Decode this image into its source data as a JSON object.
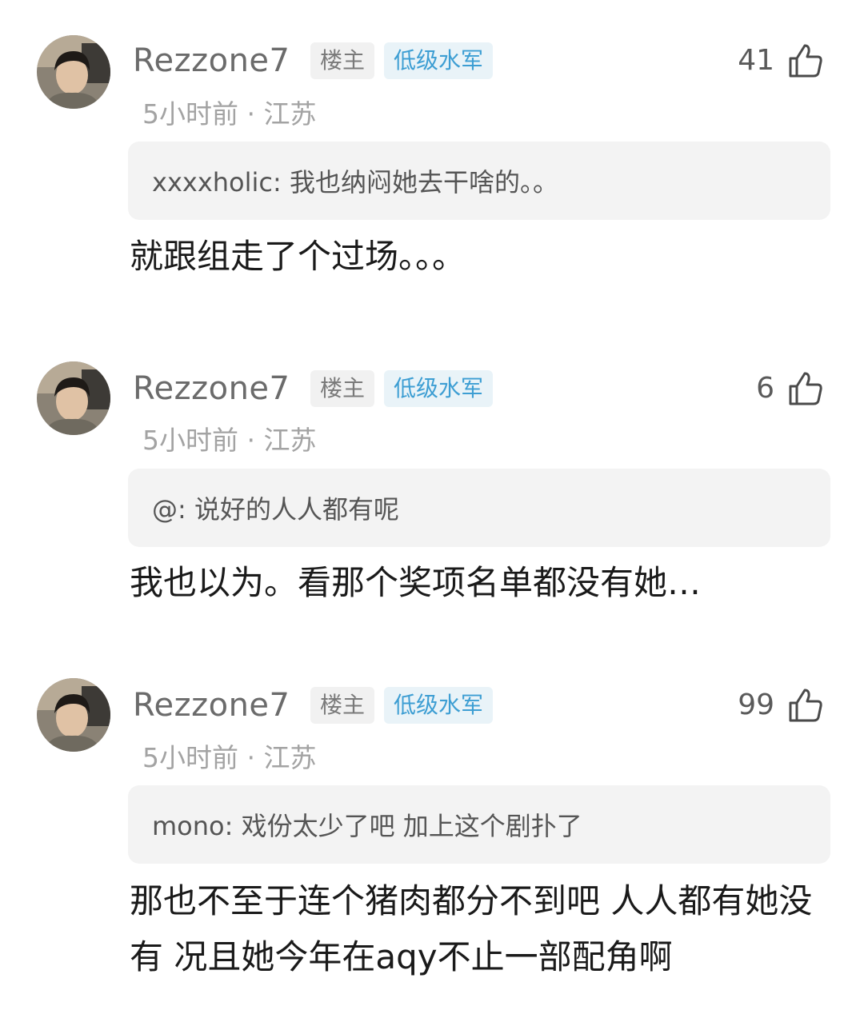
{
  "comments": [
    {
      "username": "Rezzone7",
      "owner_tag": "楼主",
      "level_tag": "低级水军",
      "likes": "41",
      "meta": "5小时前 · 江苏",
      "quote": "xxxxholic: 我也纳闷她去干啥的。。",
      "body": "就跟组走了个过场。。。"
    },
    {
      "username": "Rezzone7",
      "owner_tag": "楼主",
      "level_tag": "低级水军",
      "likes": "6",
      "meta": "5小时前 · 江苏",
      "quote": "@: 说好的人人都有呢",
      "body": "我也以为。看那个奖项名单都没有她…"
    },
    {
      "username": "Rezzone7",
      "owner_tag": "楼主",
      "level_tag": "低级水军",
      "likes": "99",
      "meta": "5小时前 · 江苏",
      "quote": "mono: 戏份太少了吧 加上这个剧扑了",
      "body": "那也不至于连个猪肉都分不到吧 人人都有她没有 况且她今年在aqy不止一部配角啊"
    }
  ],
  "icons": {
    "like": "thumbs-up-icon",
    "avatar": "user-avatar"
  },
  "colors": {
    "username": "#6b6b6b",
    "level_tag_text": "#3d9ed3",
    "level_tag_bg": "#e9f3f8",
    "owner_tag_bg": "#f1f1f1",
    "quote_bg": "#f3f3f3",
    "meta": "#a3a3a3"
  }
}
